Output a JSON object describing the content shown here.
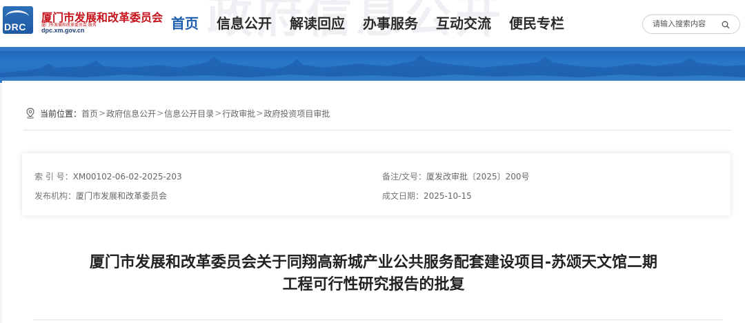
{
  "header": {
    "bg_text": "政府信息公开",
    "logo": {
      "abbr": "DRC",
      "title": "厦门市发展和改革委员会",
      "subtitle": "厦门市发展和改革委员会 政务",
      "url": "dpc.xm.gov.cn"
    },
    "nav": [
      {
        "label": "首页",
        "active": true
      },
      {
        "label": "信息公开",
        "active": false
      },
      {
        "label": "解读回应",
        "active": false
      },
      {
        "label": "办事服务",
        "active": false
      },
      {
        "label": "互动交流",
        "active": false
      },
      {
        "label": "便民专栏",
        "active": false
      }
    ],
    "search": {
      "placeholder": "请输入搜索内容",
      "icon": "search-icon"
    }
  },
  "breadcrumb": {
    "icon": "location-pin-icon",
    "current_label": "当前位置：",
    "items": [
      "首页",
      "政府信息公开",
      "信息公开目录",
      "行政审批",
      "政府投资项目审批"
    ],
    "separator": ">"
  },
  "info": {
    "index_label": "索 引 号：",
    "index_value": "XM00102-06-02-2025-203",
    "remark_label": "备注/文号：",
    "remark_value": "厦发改审批〔2025〕200号",
    "publisher_label": "发布机构：",
    "publisher_value": "厦门市发展和改革委员会",
    "date_label": "成文日期：",
    "date_value": "2025-10-15"
  },
  "document": {
    "title_line1": "厦门市发展和改革委员会关于同翔高新城产业公共服务配套建设项目-苏颂天文馆二期",
    "title_line2": "工程可行性研究报告的批复"
  },
  "colors": {
    "nav_active": "#1f5fb1",
    "logo_red": "#c6141c",
    "banner_blue": "#2a78c9"
  }
}
